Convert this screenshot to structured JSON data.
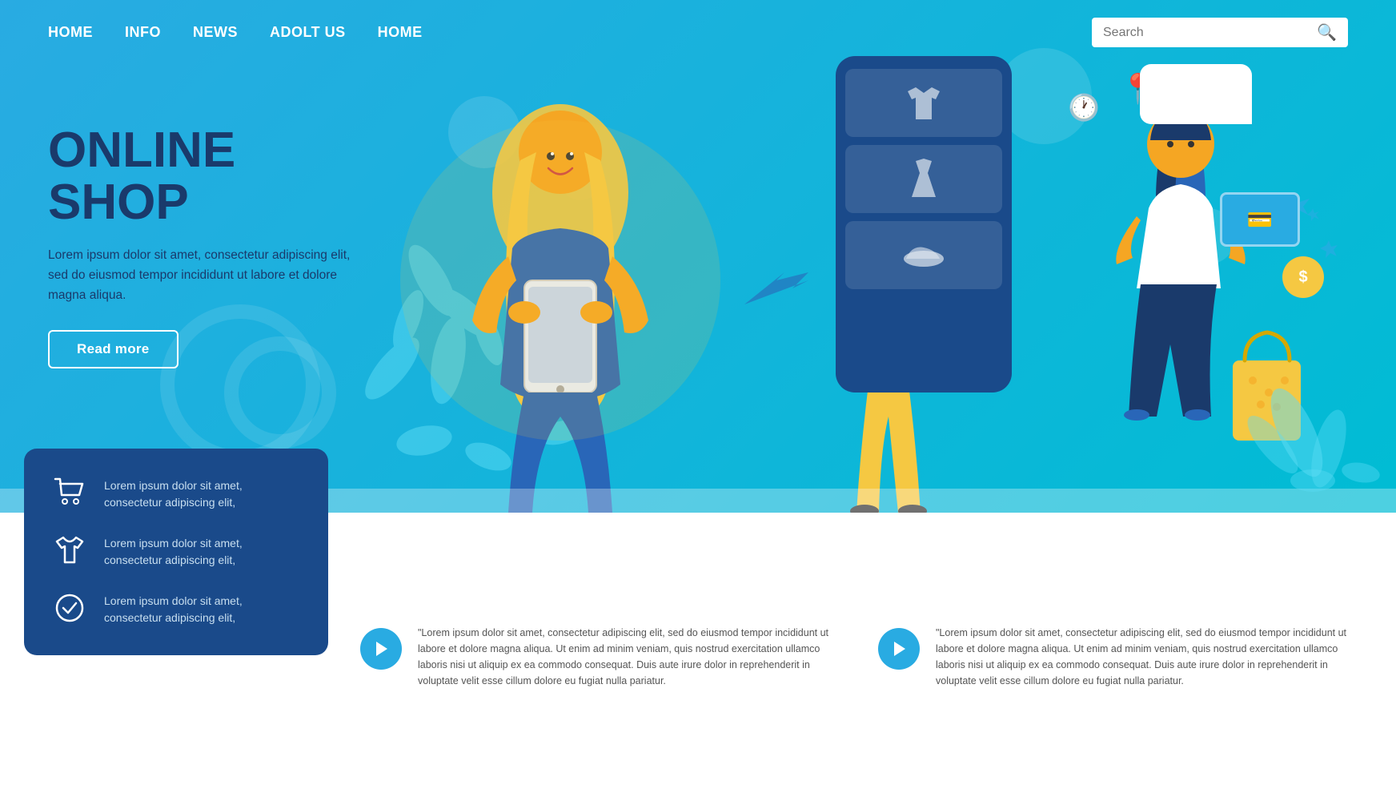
{
  "nav": {
    "links": [
      {
        "label": "HOME",
        "href": "#"
      },
      {
        "label": "INFO",
        "href": "#"
      },
      {
        "label": "NEWS",
        "href": "#"
      },
      {
        "label": "ADOLT US",
        "href": "#"
      },
      {
        "label": "HOME",
        "href": "#"
      }
    ],
    "search_placeholder": "Search"
  },
  "hero": {
    "title_line1": "ONLINE",
    "title_line2": "SHOP",
    "description": "Lorem ipsum dolor sit amet, consectetur adipiscing elit, sed do eiusmod tempor incididunt ut labore et dolore magna aliqua.",
    "read_more_label": "Read more"
  },
  "info_card": {
    "items": [
      {
        "icon": "🛒",
        "text": "Lorem ipsum dolor sit amet, consectetur adipiscing elit,"
      },
      {
        "icon": "👕",
        "text": "Lorem ipsum dolor sit amet, consectetur adipiscing elit,"
      },
      {
        "icon": "✔",
        "text": "Lorem ipsum dolor sit amet, consectetur adipiscing elit,"
      }
    ]
  },
  "bottom_blocks": [
    {
      "text": "\"Lorem ipsum dolor sit amet, consectetur adipiscing elit, sed do eiusmod tempor incididunt ut labore et dolore magna aliqua. Ut enim ad minim veniam, quis nostrud exercitation ullamco laboris nisi ut aliquip ex ea commodo consequat. Duis aute irure dolor in reprehenderit in voluptate velit esse cillum dolore eu fugiat nulla pariatur."
    },
    {
      "text": "\"Lorem ipsum dolor sit amet, consectetur adipiscing elit, sed do eiusmod tempor incididunt ut labore et dolore magna aliqua. Ut enim ad minim veniam, quis nostrud exercitation ullamco laboris nisi ut aliquip ex ea commodo consequat. Duis aute irure dolor in reprehenderit in voluptate velit esse cillum dolore eu fugiat nulla pariatur."
    }
  ],
  "colors": {
    "primary_blue": "#29abe2",
    "dark_blue": "#1a4a8a",
    "light_bg": "#e8f7fd",
    "text_dark": "#1a3a6b",
    "yellow": "#f5c842"
  }
}
